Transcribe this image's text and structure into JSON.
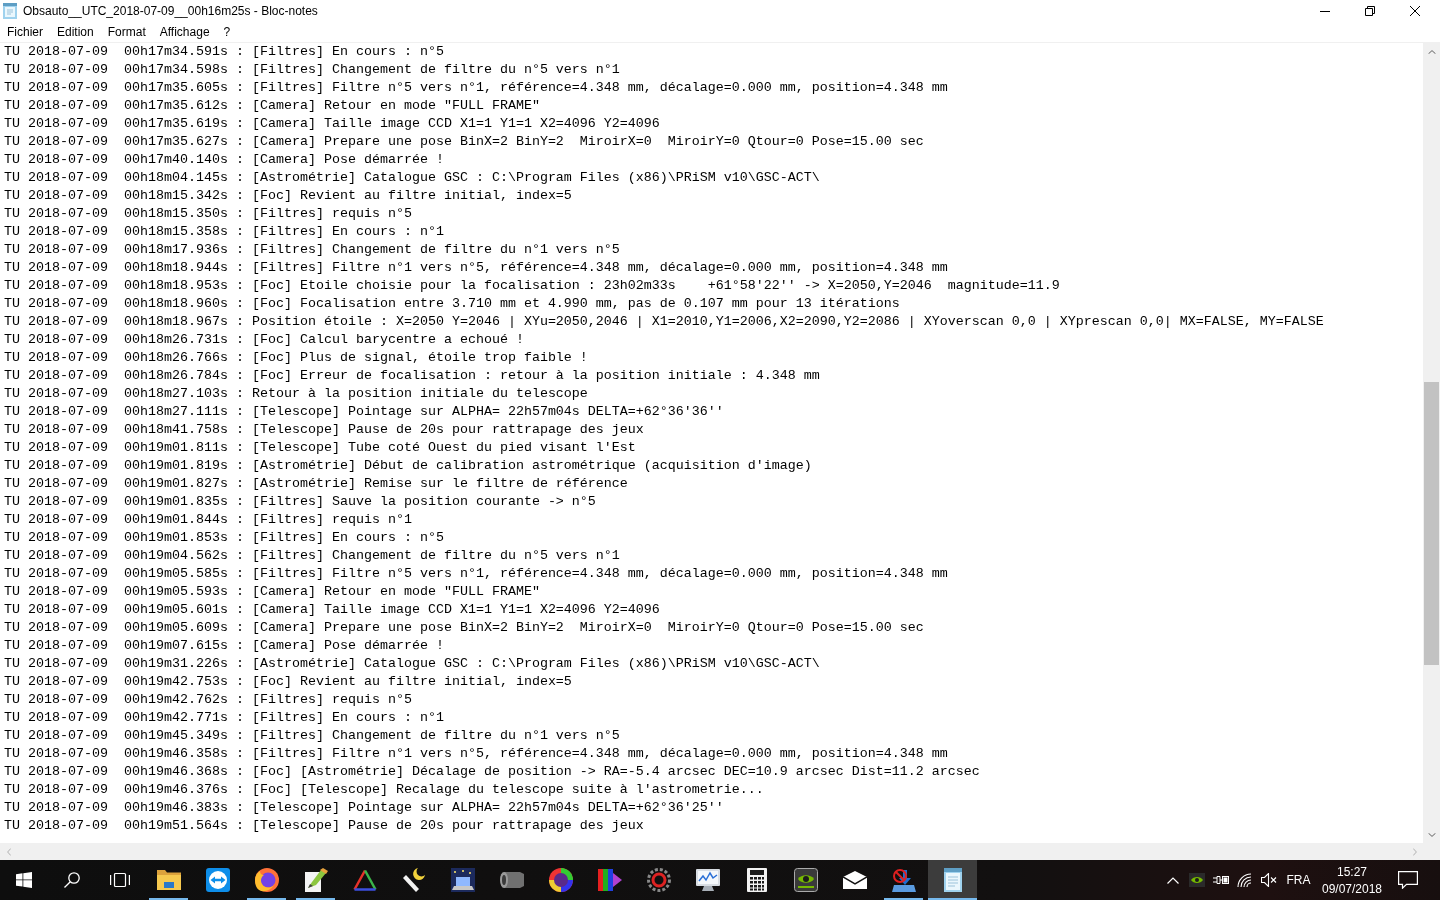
{
  "window": {
    "title": "Obsauto__UTC_2018-07-09__00h16m25s - Bloc-notes"
  },
  "menu": [
    "Fichier",
    "Edition",
    "Format",
    "Affichage",
    "?"
  ],
  "document": {
    "lines": [
      "TU 2018-07-09  00h17m34.591s : [Filtres] En cours : n°5",
      "TU 2018-07-09  00h17m34.598s : [Filtres] Changement de filtre du n°5 vers n°1",
      "TU 2018-07-09  00h17m35.605s : [Filtres] Filtre n°5 vers n°1, référence=4.348 mm, décalage=0.000 mm, position=4.348 mm",
      "TU 2018-07-09  00h17m35.612s : [Camera] Retour en mode \"FULL FRAME\"",
      "TU 2018-07-09  00h17m35.619s : [Camera] Taille image CCD X1=1 Y1=1 X2=4096 Y2=4096",
      "TU 2018-07-09  00h17m35.627s : [Camera] Prepare une pose BinX=2 BinY=2  MiroirX=0  MiroirY=0 Qtour=0 Pose=15.00 sec",
      "TU 2018-07-09  00h17m40.140s : [Camera] Pose démarrée !",
      "TU 2018-07-09  00h18m04.145s : [Astrométrie] Catalogue GSC : C:\\Program Files (x86)\\PRiSM v10\\GSC-ACT\\",
      "TU 2018-07-09  00h18m15.342s : [Foc] Revient au filtre initial, index=5",
      "TU 2018-07-09  00h18m15.350s : [Filtres] requis n°5",
      "TU 2018-07-09  00h18m15.358s : [Filtres] En cours : n°1",
      "TU 2018-07-09  00h18m17.936s : [Filtres] Changement de filtre du n°1 vers n°5",
      "TU 2018-07-09  00h18m18.944s : [Filtres] Filtre n°1 vers n°5, référence=4.348 mm, décalage=0.000 mm, position=4.348 mm",
      "TU 2018-07-09  00h18m18.953s : [Foc] Etoile choisie pour la focalisation : 23h02m33s    +61°58'22'' -> X=2050,Y=2046  magnitude=11.9",
      "TU 2018-07-09  00h18m18.960s : [Foc] Focalisation entre 3.710 mm et 4.990 mm, pas de 0.107 mm pour 13 itérations",
      "TU 2018-07-09  00h18m18.967s : Position étoile : X=2050 Y=2046 | XYu=2050,2046 | X1=2010,Y1=2006,X2=2090,Y2=2086 | XYoverscan 0,0 | XYprescan 0,0| MX=FALSE, MY=FALSE",
      "TU 2018-07-09  00h18m26.731s : [Foc] Calcul barycentre a echoué !",
      "TU 2018-07-09  00h18m26.766s : [Foc] Plus de signal, étoile trop faible !",
      "TU 2018-07-09  00h18m26.784s : [Foc] Erreur de focalisation : retour à la position initiale : 4.348 mm",
      "TU 2018-07-09  00h18m27.103s : Retour à la position initiale du telescope",
      "TU 2018-07-09  00h18m27.111s : [Telescope] Pointage sur ALPHA= 22h57m04s DELTA=+62°36'36''",
      "TU 2018-07-09  00h18m41.758s : [Telescope] Pause de 20s pour rattrapage des jeux",
      "TU 2018-07-09  00h19m01.811s : [Telescope] Tube coté Ouest du pied visant l'Est",
      "TU 2018-07-09  00h19m01.819s : [Astrométrie] Début de calibration astrométrique (acquisition d'image)",
      "TU 2018-07-09  00h19m01.827s : [Astrométrie] Remise sur le filtre de référence",
      "TU 2018-07-09  00h19m01.835s : [Filtres] Sauve la position courante -> n°5",
      "TU 2018-07-09  00h19m01.844s : [Filtres] requis n°1",
      "TU 2018-07-09  00h19m01.853s : [Filtres] En cours : n°5",
      "TU 2018-07-09  00h19m04.562s : [Filtres] Changement de filtre du n°5 vers n°1",
      "TU 2018-07-09  00h19m05.585s : [Filtres] Filtre n°5 vers n°1, référence=4.348 mm, décalage=0.000 mm, position=4.348 mm",
      "TU 2018-07-09  00h19m05.593s : [Camera] Retour en mode \"FULL FRAME\"",
      "TU 2018-07-09  00h19m05.601s : [Camera] Taille image CCD X1=1 Y1=1 X2=4096 Y2=4096",
      "TU 2018-07-09  00h19m05.609s : [Camera] Prepare une pose BinX=2 BinY=2  MiroirX=0  MiroirY=0 Qtour=0 Pose=15.00 sec",
      "TU 2018-07-09  00h19m07.615s : [Camera] Pose démarrée !",
      "TU 2018-07-09  00h19m31.226s : [Astrométrie] Catalogue GSC : C:\\Program Files (x86)\\PRiSM v10\\GSC-ACT\\",
      "TU 2018-07-09  00h19m42.753s : [Foc] Revient au filtre initial, index=5",
      "TU 2018-07-09  00h19m42.762s : [Filtres] requis n°5",
      "TU 2018-07-09  00h19m42.771s : [Filtres] En cours : n°1",
      "TU 2018-07-09  00h19m45.349s : [Filtres] Changement de filtre du n°1 vers n°5",
      "TU 2018-07-09  00h19m46.358s : [Filtres] Filtre n°1 vers n°5, référence=4.348 mm, décalage=0.000 mm, position=4.348 mm",
      "TU 2018-07-09  00h19m46.368s : [Foc] [Astrométrie] Décalage de position -> RA=-5.4 arcsec DEC=10.9 arcsec Dist=11.2 arcsec",
      "TU 2018-07-09  00h19m46.376s : [Foc] [Telescope] Recalage du telescope suite à l'astrometrie...",
      "TU 2018-07-09  00h19m46.383s : [Telescope] Pointage sur ALPHA= 22h57m04s DELTA=+62°36'25''",
      "TU 2018-07-09  00h19m51.564s : [Telescope] Pause de 20s pour rattrapage des jeux"
    ]
  },
  "taskbar": {
    "apps": [
      {
        "kind": "folder",
        "open": true,
        "selected": false
      },
      {
        "kind": "remote",
        "open": false,
        "selected": false
      },
      {
        "kind": "browser",
        "open": true,
        "selected": false
      },
      {
        "kind": "paint",
        "open": true,
        "selected": false
      },
      {
        "kind": "prism",
        "open": false,
        "selected": false
      },
      {
        "kind": "wand",
        "open": false,
        "selected": false
      },
      {
        "kind": "laptop",
        "open": false,
        "selected": false
      },
      {
        "kind": "lens",
        "open": false,
        "selected": false
      },
      {
        "kind": "wheel",
        "open": false,
        "selected": false
      },
      {
        "kind": "bars",
        "open": false,
        "selected": false
      },
      {
        "kind": "gear",
        "open": false,
        "selected": false
      },
      {
        "kind": "monitor",
        "open": false,
        "selected": false
      },
      {
        "kind": "calculator",
        "open": false,
        "selected": false
      },
      {
        "kind": "gpu",
        "open": false,
        "selected": false
      },
      {
        "kind": "mail",
        "open": false,
        "selected": false
      },
      {
        "kind": "download",
        "open": true,
        "selected": false
      },
      {
        "kind": "notepad",
        "open": true,
        "selected": true
      }
    ],
    "tray": {
      "language": "FRA",
      "time": "15:27",
      "date": "09/07/2018"
    }
  }
}
